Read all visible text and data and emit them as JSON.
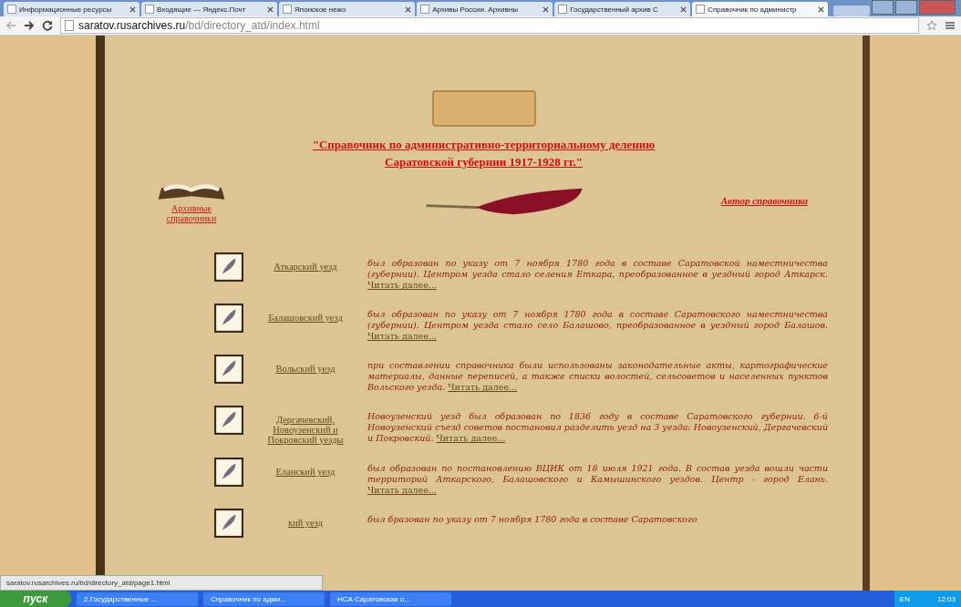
{
  "tabs": [
    {
      "label": "Информационные ресурсы",
      "selected": false
    },
    {
      "label": "Входящие — Яндекс.Почт",
      "selected": false
    },
    {
      "label": "Японское нежо",
      "selected": false
    },
    {
      "label": "Архивы России. Архивны",
      "selected": false
    },
    {
      "label": "Государственный архив С",
      "selected": false
    },
    {
      "label": "Справочник по администр",
      "selected": true
    }
  ],
  "address": {
    "host": "saratov.rusarchives.ru",
    "path": "/bd/directory_atd/index.html"
  },
  "page": {
    "title_line_1": "\"Справочник по административно-территориальному делению",
    "title_line_2": "Саратовской губернии 1917-1928 гг.\"",
    "archive_link": "Архивные справочники",
    "author_link": "Автор справочника",
    "entries": [
      {
        "name": "Аткарский уезд",
        "text": "был образован по указу от 7 ноября 1780 года в составе Саратовской наместничества (губернии). Центром уезда стало селения Еткара, преобразованное в уездный город Аткарск.",
        "more": "Читать далее..."
      },
      {
        "name": "Балашовский уезд",
        "text": "был образован по указу от 7 ноября 1780 года в составе Саратовского наместничества (губернии). Центром уезда стало село Балашово, преобразованное в уездный город Балашов.",
        "more": "Читать далее..."
      },
      {
        "name": "Вольский уезд",
        "text": "при составлении справочника были использованы законодательные акты, картографические материалы, данные переписей, а также списки волостей, сельсоветов и населенных пунктов Вольского уезда.",
        "more": "Читать далее..."
      },
      {
        "name": "Дергачевский, Новоузенский и Покровский уезды",
        "text": "Новоузенский уезд был образован по 1836 году в составе Саратовского губернии. 6-й Новоузенский съезд советов постановил разделить уезд на 3 уезда: Новоузенский, Дергачевский и Покровский.",
        "more": "Читать далее..."
      },
      {
        "name": "Еланский уезд",
        "text": "был образован по постановлению ВЦИК от 18 июля 1921 года. В состав уезда вошли части территорий Аткарского, Балашовского и Камышинского уездов. Центр - город Елань.",
        "more": "Читать далее..."
      },
      {
        "name": "кий уезд",
        "text": "был бразован по указу от 7 ноября 1780 года в составе Саратовского"
      }
    ]
  },
  "status_url": "saratov.rusarchives.ru/bd/directory_atd/page1.html",
  "taskbar": {
    "start": "пуск",
    "items": [
      "2.Государственные ...",
      "Справочник по адми...",
      "НСА Саратовская о..."
    ],
    "lang": "EN",
    "clock": "12:03"
  }
}
